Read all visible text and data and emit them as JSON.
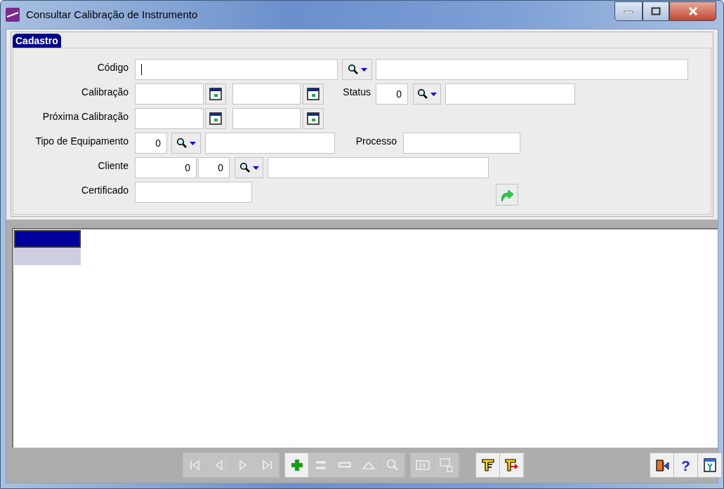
{
  "window": {
    "title": "Consultar Calibração de Instrumento"
  },
  "tabs": [
    {
      "label": "Cadastro",
      "selected": true
    }
  ],
  "form": {
    "codigo": {
      "label": "Código",
      "focused": true
    },
    "calibracao": {
      "label": "Calibração"
    },
    "status": {
      "label": "Status",
      "value": "0"
    },
    "proxima": {
      "label": "Próxima Calibração"
    },
    "tipo": {
      "label": "Tipo de Equipamento",
      "value": "0"
    },
    "processo": {
      "label": "Processo"
    },
    "cliente": {
      "label": "Cliente",
      "values": [
        "0",
        "0"
      ]
    },
    "certificado": {
      "label": "Certificado"
    }
  },
  "grid": {
    "rows": [
      {
        "selected": true
      },
      {
        "selected": false
      }
    ]
  },
  "toolbar": [
    {
      "kind": "first",
      "disabled": true
    },
    {
      "kind": "prev",
      "disabled": true
    },
    {
      "kind": "next",
      "disabled": true
    },
    {
      "kind": "last",
      "disabled": true
    },
    {
      "kind": "add",
      "disabled": false
    },
    {
      "kind": "edit",
      "disabled": true
    },
    {
      "kind": "delete",
      "disabled": true
    },
    {
      "kind": "post",
      "disabled": true
    },
    {
      "kind": "search",
      "disabled": true
    },
    {
      "kind": "grid",
      "disabled": true
    },
    {
      "kind": "export",
      "disabled": true
    },
    {
      "kind": "filter",
      "disabled": false
    },
    {
      "kind": "filter-apply",
      "disabled": false
    },
    {
      "kind": "exit",
      "disabled": false
    },
    {
      "kind": "help",
      "disabled": false,
      "label": "?"
    },
    {
      "kind": "config",
      "disabled": false
    }
  ]
}
